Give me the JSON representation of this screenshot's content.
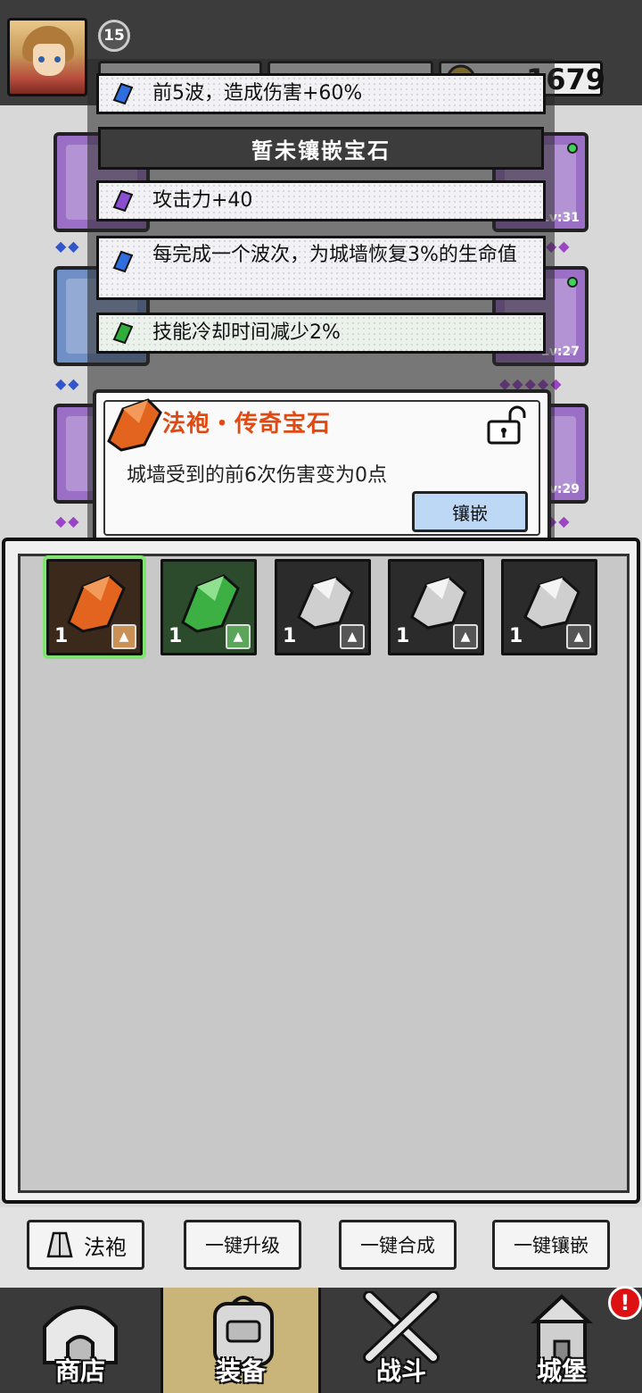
{
  "player": {
    "level": "15",
    "gold_partial": "1679"
  },
  "equip_slots": {
    "right_top_level": "Lv:31",
    "right_mid_level": "Lv:27",
    "right_bottom_level": "Lv:29"
  },
  "gem_stats": [
    {
      "text": "前5波，造成伤害+60%",
      "gem": "blue"
    },
    {
      "text": "暂未镶嵌宝石",
      "gem": "none"
    },
    {
      "text": "攻击力+40",
      "gem": "purple"
    },
    {
      "text": "每完成一个波次，为城墙恢复3%的生命值",
      "gem": "blue"
    },
    {
      "text": "技能冷却时间减少2%",
      "gem": "green"
    }
  ],
  "tooltip": {
    "title": "法袍・传奇宝石",
    "description": "城墙受到的前6次伤害变为0点",
    "inlay_button": "镶嵌"
  },
  "inventory": [
    {
      "count": "1",
      "type": "orange",
      "selected": true
    },
    {
      "count": "1",
      "type": "green",
      "selected": false
    },
    {
      "count": "1",
      "type": "grey",
      "selected": false
    },
    {
      "count": "1",
      "type": "grey",
      "selected": false
    },
    {
      "count": "1",
      "type": "grey",
      "selected": false
    }
  ],
  "actions": {
    "robe": "法袍",
    "upgrade_all": "一键升级",
    "merge_all": "一键合成",
    "inlay_all": "一键镶嵌"
  },
  "nav": {
    "shop": "商店",
    "equip": "装备",
    "battle": "战斗",
    "castle": "城堡",
    "alert": "!"
  },
  "colors": {
    "tooltip_title": "#e04a12",
    "inlay_button": "#bcd8f4",
    "nav_active": "#c9b57a",
    "selected_outline": "#7ee36f"
  }
}
